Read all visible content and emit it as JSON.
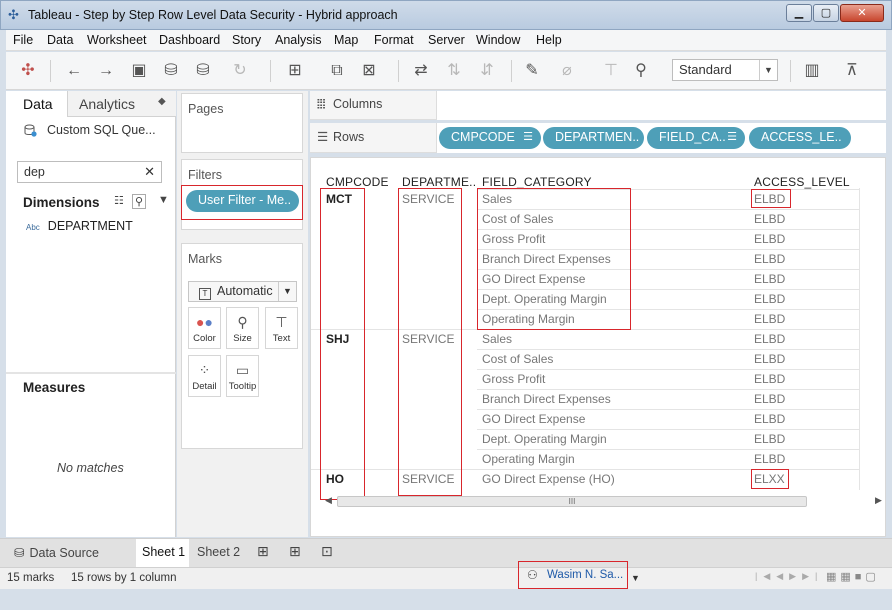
{
  "window": {
    "title": "Tableau - Step by Step Row Level Data Security - Hybrid approach"
  },
  "menu": [
    "File",
    "Data",
    "Worksheet",
    "Dashboard",
    "Story",
    "Analysis",
    "Map",
    "Format",
    "Server",
    "Window",
    "Help"
  ],
  "toolbar": {
    "fit_value": "Standard"
  },
  "data_pane": {
    "tab_data": "Data",
    "tab_analytics": "Analytics",
    "datasource": "Custom SQL Que...",
    "search_value": "dep",
    "dimensions_header": "Dimensions",
    "dimension_field": "DEPARTMENT",
    "dimension_type": "Abc",
    "measures_header": "Measures",
    "measures_empty": "No matches"
  },
  "cards": {
    "pages_title": "Pages",
    "filters_title": "Filters",
    "filter_pill": "User Filter - Me..",
    "marks_title": "Marks",
    "mark_type": "Automatic",
    "mark_buttons": {
      "color": "Color",
      "size": "Size",
      "text": "Text",
      "detail": "Detail",
      "tooltip": "Tooltip"
    }
  },
  "shelves": {
    "columns_label": "Columns",
    "rows_label": "Rows",
    "row_pills": [
      "CMPCODE",
      "DEPARTMEN..",
      "FIELD_CA..",
      "ACCESS_LE.."
    ]
  },
  "table": {
    "headers": [
      "CMPCODE",
      "DEPARTME..",
      "FIELD_CATEGORY",
      "ACCESS_LEVEL"
    ],
    "groups": [
      {
        "cmpcode": "MCT",
        "department": "SERVICE",
        "rows": [
          {
            "field": "Sales",
            "access": "ELBD"
          },
          {
            "field": "Cost of Sales",
            "access": "ELBD"
          },
          {
            "field": "Gross Profit",
            "access": "ELBD"
          },
          {
            "field": "Branch Direct Expenses",
            "access": "ELBD"
          },
          {
            "field": "GO Direct Expense",
            "access": "ELBD"
          },
          {
            "field": "Dept. Operating Margin",
            "access": "ELBD"
          },
          {
            "field": "Operating Margin",
            "access": "ELBD"
          }
        ]
      },
      {
        "cmpcode": "SHJ",
        "department": "SERVICE",
        "rows": [
          {
            "field": "Sales",
            "access": "ELBD"
          },
          {
            "field": "Cost of Sales",
            "access": "ELBD"
          },
          {
            "field": "Gross Profit",
            "access": "ELBD"
          },
          {
            "field": "Branch Direct Expenses",
            "access": "ELBD"
          },
          {
            "field": "GO Direct Expense",
            "access": "ELBD"
          },
          {
            "field": "Dept. Operating Margin",
            "access": "ELBD"
          },
          {
            "field": "Operating Margin",
            "access": "ELBD"
          }
        ]
      },
      {
        "cmpcode": "HO",
        "department": "SERVICE",
        "rows": [
          {
            "field": "GO Direct Expense (HO)",
            "access": "ELXX"
          }
        ]
      }
    ],
    "scroll_grip": "III"
  },
  "sheet_tabs": {
    "data_source": "Data Source",
    "sheet1": "Sheet 1",
    "sheet2": "Sheet 2"
  },
  "status": {
    "marks": "15 marks",
    "dims": "15 rows by 1 column",
    "user": "Wasim N. Sa..."
  }
}
